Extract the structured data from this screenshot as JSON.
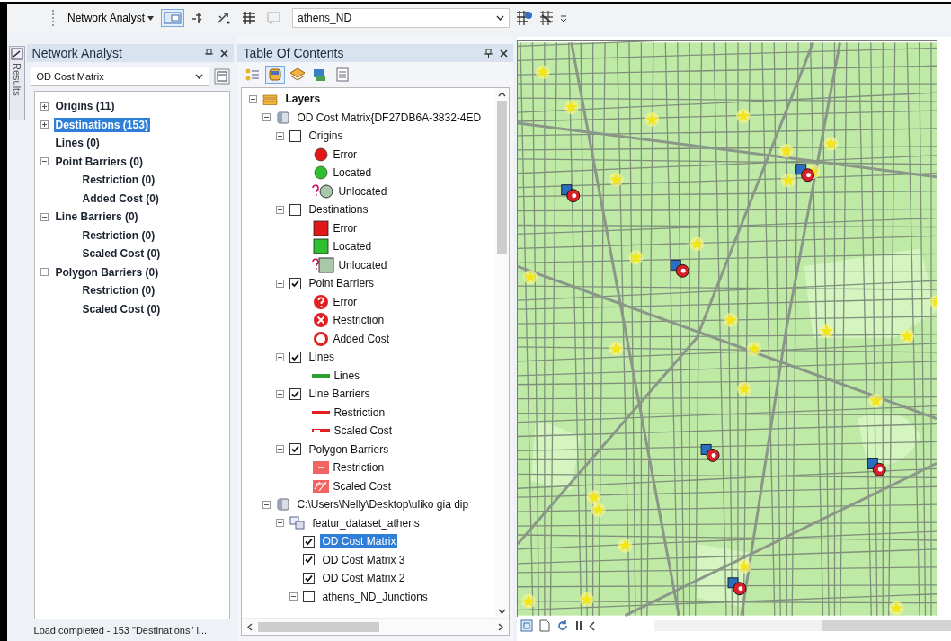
{
  "toolbar": {
    "menu": "Network Analyst",
    "network_dataset": "athens_ND",
    "tools": [
      {
        "selected": true
      },
      {
        "selected": false
      },
      {
        "selected": false
      },
      {
        "selected": false
      },
      {
        "selected": false
      }
    ]
  },
  "side_tab": {
    "label": "Results"
  },
  "network_analyst": {
    "title": "Network Analyst",
    "analysis": "OD Cost Matrix",
    "tree": [
      {
        "label": "Origins (11)",
        "expanded": false,
        "selected": false
      },
      {
        "label": "Destinations (153)",
        "expanded": false,
        "selected": true
      },
      {
        "label": "Lines (0)",
        "selected": false
      },
      {
        "label": "Point Barriers (0)",
        "expanded": true,
        "selected": false,
        "children": [
          {
            "label": "Restriction (0)",
            "selected": false
          },
          {
            "label": "Added Cost (0)",
            "selected": false
          }
        ]
      },
      {
        "label": "Line Barriers (0)",
        "expanded": true,
        "selected": false,
        "children": [
          {
            "label": "Restriction (0)",
            "selected": false
          },
          {
            "label": "Scaled Cost (0)",
            "selected": false
          }
        ]
      },
      {
        "label": "Polygon Barriers (0)",
        "expanded": true,
        "selected": false,
        "children": [
          {
            "label": "Restriction (0)",
            "selected": false
          },
          {
            "label": "Scaled Cost (0)",
            "selected": false
          }
        ]
      }
    ],
    "status": "Load completed - 153 \"Destinations\" l..."
  },
  "toc": {
    "title": "Table Of Contents",
    "view_buttons": [
      {
        "selected": false
      },
      {
        "selected": true
      },
      {
        "selected": false
      },
      {
        "selected": false
      },
      {
        "selected": false
      }
    ],
    "tree": [
      {
        "kind": "group",
        "label": "Layers",
        "expanded": true,
        "selected": false,
        "children": [
          {
            "kind": "analysis",
            "label": "OD Cost Matrix{DF27DB6A-3832-4ED",
            "expanded": true,
            "selected": false,
            "children": [
              {
                "kind": "layer",
                "label": "Origins",
                "expanded": true,
                "checked": false,
                "selected": false,
                "legend": [
                  {
                    "kind": "circle",
                    "color": "#e01818",
                    "label": "Error"
                  },
                  {
                    "kind": "circle",
                    "color": "#2ec02e",
                    "label": "Located"
                  },
                  {
                    "kind": "circle-query",
                    "color": "#a9c8a9",
                    "label": "Unlocated"
                  }
                ]
              },
              {
                "kind": "layer",
                "label": "Destinations",
                "expanded": true,
                "checked": false,
                "selected": false,
                "legend": [
                  {
                    "kind": "square",
                    "color": "#e01818",
                    "label": "Error"
                  },
                  {
                    "kind": "square",
                    "color": "#2ec02e",
                    "label": "Located"
                  },
                  {
                    "kind": "square-query",
                    "color": "#a9c8a9",
                    "label": "Unlocated"
                  }
                ]
              },
              {
                "kind": "layer",
                "label": "Point Barriers",
                "expanded": true,
                "checked": true,
                "selected": false,
                "legend": [
                  {
                    "kind": "query-circle",
                    "color": "#e02020",
                    "label": "Error"
                  },
                  {
                    "kind": "cross-circle",
                    "color": "#e02020",
                    "label": "Restriction"
                  },
                  {
                    "kind": "ring",
                    "color": "#e02020",
                    "label": "Added Cost"
                  }
                ]
              },
              {
                "kind": "layer",
                "label": "Lines",
                "expanded": true,
                "checked": true,
                "selected": false,
                "legend": [
                  {
                    "kind": "line",
                    "color": "#2e9e2e",
                    "label": "Lines"
                  }
                ]
              },
              {
                "kind": "layer",
                "label": "Line Barriers",
                "expanded": true,
                "checked": true,
                "selected": false,
                "legend": [
                  {
                    "kind": "line",
                    "color": "#e02020",
                    "label": "Restriction"
                  },
                  {
                    "kind": "dashed-line",
                    "color": "#e02020",
                    "label": "Scaled Cost"
                  }
                ]
              },
              {
                "kind": "layer",
                "label": "Polygon Barriers",
                "expanded": true,
                "checked": true,
                "selected": false,
                "legend": [
                  {
                    "kind": "polygon",
                    "color": "#f06464",
                    "label": "Restriction"
                  },
                  {
                    "kind": "hatched-polygon",
                    "color": "#f06464",
                    "label": "Scaled Cost"
                  }
                ]
              }
            ]
          },
          {
            "kind": "analysis",
            "label": "C:\\Users\\Nelly\\Desktop\\uliko gia dip",
            "expanded": true,
            "selected": false,
            "children": [
              {
                "kind": "dataset",
                "label": "featur_dataset_athens",
                "expanded": true,
                "selected": false,
                "children": [
                  {
                    "kind": "layer",
                    "label": "OD Cost Matrix",
                    "checked": true,
                    "selected": true
                  },
                  {
                    "kind": "layer",
                    "label": "OD Cost Matrix 3",
                    "checked": true,
                    "selected": false
                  },
                  {
                    "kind": "layer",
                    "label": "OD Cost Matrix 2",
                    "checked": true,
                    "selected": false
                  },
                  {
                    "kind": "layer",
                    "label": "athens_ND_Junctions",
                    "expanded": true,
                    "checked": false,
                    "selected": false
                  }
                ]
              }
            ]
          }
        ]
      }
    ]
  }
}
